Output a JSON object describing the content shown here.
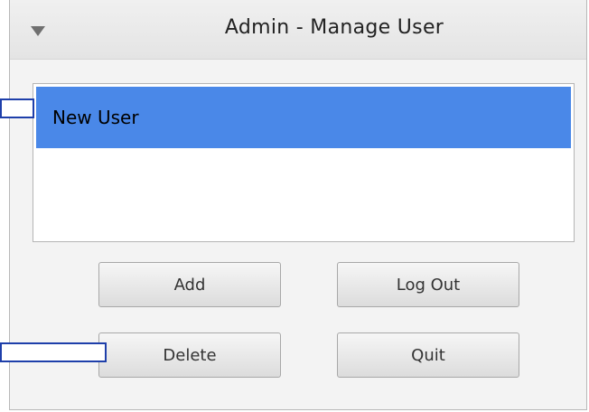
{
  "window": {
    "title": "Admin - Manage User"
  },
  "users_list": {
    "items": [
      {
        "label": "New User",
        "selected": true
      }
    ]
  },
  "buttons": {
    "add_label": "Add",
    "logout_label": "Log Out",
    "delete_label": "Delete",
    "quit_label": "Quit"
  },
  "colors": {
    "selection": "#4a88e8",
    "annotation_border": "#1e3faa"
  }
}
